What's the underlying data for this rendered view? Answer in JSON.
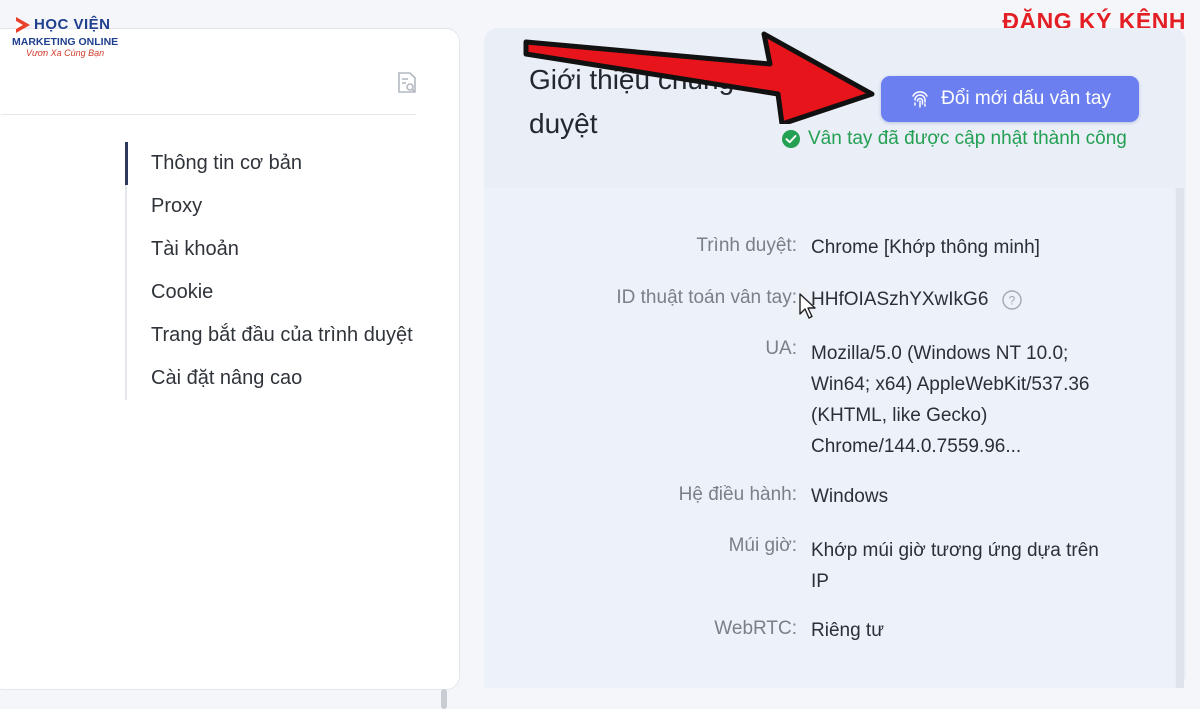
{
  "logo": {
    "line1": "HỌC VIỆN",
    "line2": "MARKETING ONLINE",
    "line3": "Vươn Xa Cùng Bạn"
  },
  "overlay": {
    "subscribe": "ĐĂNG KÝ KÊNH"
  },
  "nav": {
    "items": [
      {
        "label": "Thông tin cơ bản",
        "active": true
      },
      {
        "label": "Proxy"
      },
      {
        "label": "Tài khoản"
      },
      {
        "label": "Cookie"
      },
      {
        "label": "Trang bắt đầu của trình duyệt"
      },
      {
        "label": "Cài đặt nâng cao"
      }
    ]
  },
  "panel": {
    "title": "Giới thiệu chung về trình duyệt",
    "refresh_button": "Đổi mới dấu vân tay",
    "success_message": "Vân tay đã được cập nhật thành công",
    "rows": [
      {
        "label": "Trình duyệt:",
        "value": "Chrome [Khớp thông minh]"
      },
      {
        "label": "ID thuật toán vân tay:",
        "value": "HHfOIASzhYXwIkG6"
      },
      {
        "label": "UA:",
        "value": "Mozilla/5.0 (Windows NT 10.0; Win64; x64) AppleWebKit/537.36 (KHTML, like Gecko) Chrome/144.0.7559.96..."
      },
      {
        "label": "Hệ điều hành:",
        "value": "Windows"
      },
      {
        "label": "Múi giờ:",
        "value": "Khớp múi giờ tương ứng dựa trên IP"
      },
      {
        "label": "WebRTC:",
        "value": "Riêng tư"
      }
    ]
  },
  "icons": {
    "doc": "document-search-icon",
    "fingerprint": "fingerprint-icon",
    "check": "check-circle-icon",
    "help": "help-circle-icon",
    "cursor": "mouse-cursor-icon",
    "arrow": "red-arrow-annotation"
  },
  "colors": {
    "accent": "#6b7ff0",
    "success": "#23a052",
    "subscribe": "#e31e24",
    "active_nav": "#2d3a5e"
  }
}
